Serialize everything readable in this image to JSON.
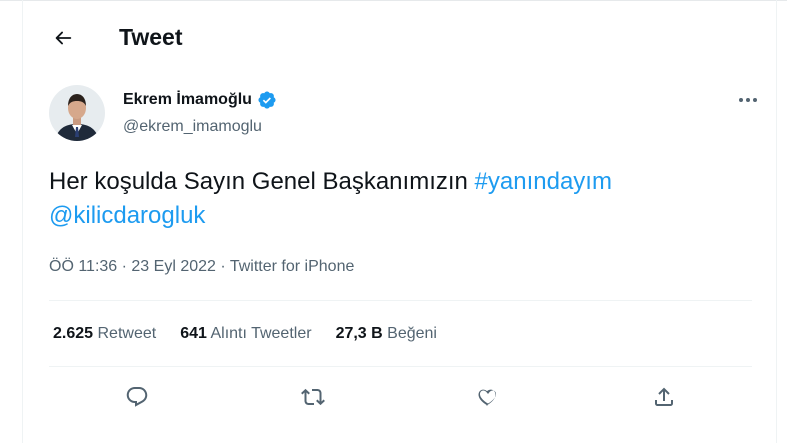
{
  "header": {
    "title": "Tweet",
    "back_icon": "arrow-left-icon"
  },
  "author": {
    "name": "Ekrem İmamoğlu",
    "handle": "@ekrem_imamoglu",
    "verified_icon": "verified-badge-icon",
    "verified_color": "#1d9bf0"
  },
  "tweet": {
    "text_plain": "Her koşulda Sayın Genel Başkanımızın ",
    "hashtag": "#yanındayım",
    "mention": "@kilicdarogluk",
    "link_color": "#1d9bf0"
  },
  "meta": {
    "time": "ÖÖ 11:36",
    "sep1": " · ",
    "date": "23 Eyl 2022",
    "sep2": " · ",
    "source": "Twitter for iPhone"
  },
  "stats": [
    {
      "count": "2.625",
      "label": "Retweet"
    },
    {
      "count": "641",
      "label": "Alıntı Tweetler"
    },
    {
      "count": "27,3 B",
      "label": "Beğeni"
    }
  ],
  "actions": [
    "reply-icon",
    "retweet-icon",
    "like-icon",
    "share-icon"
  ],
  "colors": {
    "text": "#0f1419",
    "secondary": "#536471",
    "accent": "#1d9bf0",
    "divider": "#eff3f4"
  }
}
